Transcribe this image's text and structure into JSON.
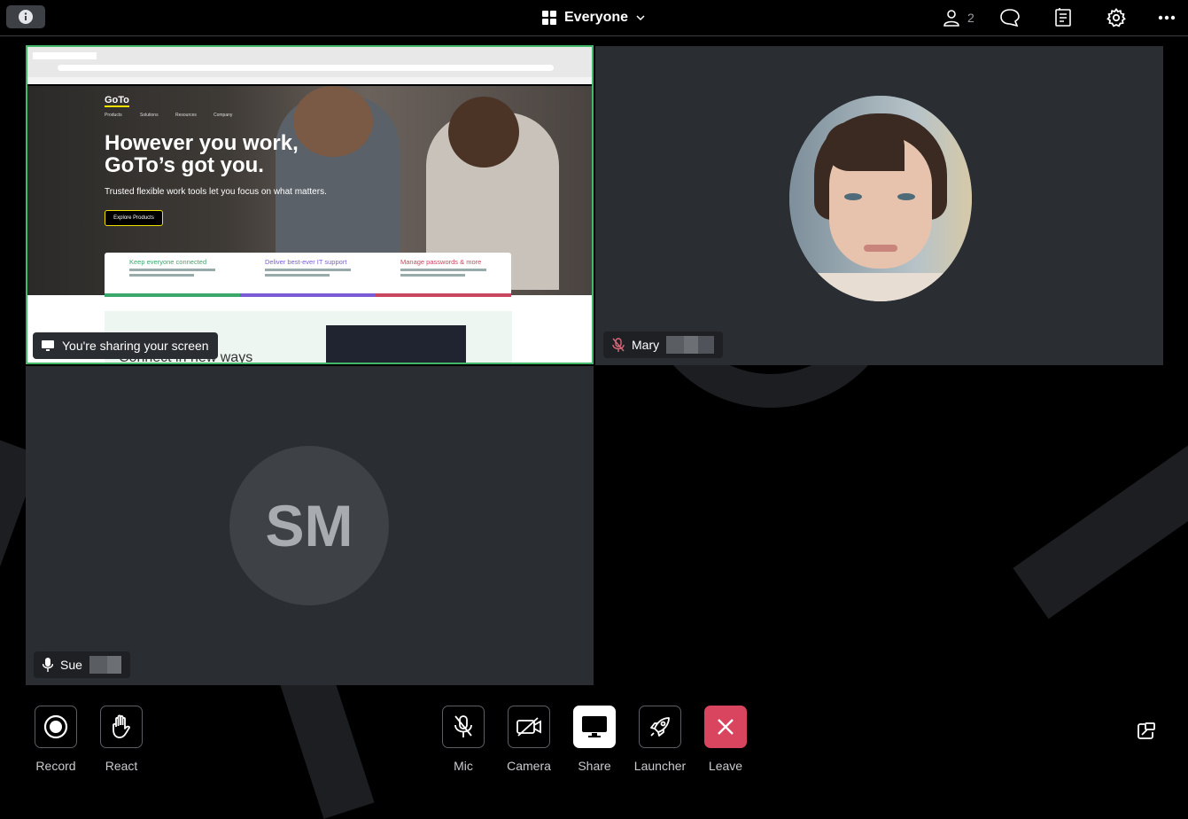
{
  "topbar": {
    "view_label": "Everyone",
    "participant_count": "2"
  },
  "tiles": {
    "share": {
      "status": "You're sharing your screen",
      "hero_title_line1": "However you work,",
      "hero_title_line2": "GoTo’s got you.",
      "hero_subtitle": "Trusted flexible work tools let you focus on what matters.",
      "hero_button": "Explore Products",
      "logo": "GoTo",
      "nav_items": [
        "Products",
        "Solutions",
        "Resources",
        "Company"
      ],
      "cards": [
        {
          "title": "Keep everyone connected",
          "color": "#3aa86b"
        },
        {
          "title": "Deliver best-ever IT support",
          "color": "#7b5cd6"
        },
        {
          "title": "Manage passwords & more",
          "color": "#c8465e"
        }
      ],
      "section_heading": "Connect in new ways"
    },
    "mary": {
      "name": "Mary"
    },
    "sue": {
      "name": "Sue",
      "initials": "SM"
    }
  },
  "controls": {
    "record": "Record",
    "react": "React",
    "mic": "Mic",
    "camera": "Camera",
    "share": "Share",
    "launcher": "Launcher",
    "leave": "Leave"
  },
  "colors": {
    "active_speaker_border": "#43b86a",
    "leave_red": "#d9455f",
    "tile_bg": "#2a2d31"
  }
}
